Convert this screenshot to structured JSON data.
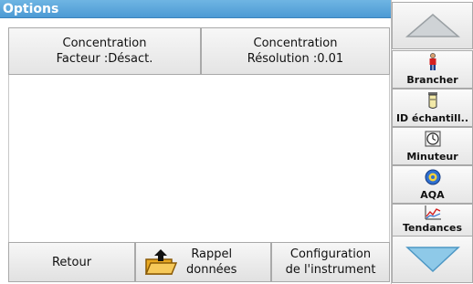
{
  "title": "Options",
  "options": {
    "concentration_factor": {
      "line1": "Concentration",
      "line2": "Facteur :Désact."
    },
    "concentration_resolution": {
      "line1": "Concentration",
      "line2": "Résolution :0.01"
    }
  },
  "bottom": {
    "back_label": "Retour",
    "recall": {
      "line1": "Rappel",
      "line2": "données"
    },
    "config": {
      "line1": "Configuration",
      "line2": "de l'instrument"
    }
  },
  "sidebar": {
    "items": [
      {
        "label": "Brancher",
        "icon": "person-icon"
      },
      {
        "label": "ID échantill..",
        "icon": "sample-vial-icon"
      },
      {
        "label": "Minuteur",
        "icon": "timer-icon"
      },
      {
        "label": "AQA",
        "icon": "aqa-icon"
      },
      {
        "label": "Tendances",
        "icon": "trend-chart-icon"
      }
    ]
  },
  "colors": {
    "titlebar": "#4c9ad4",
    "accent_red": "#d42020",
    "accent_blue": "#2f6fd0",
    "arrow_fill": "#8ec9e8"
  }
}
